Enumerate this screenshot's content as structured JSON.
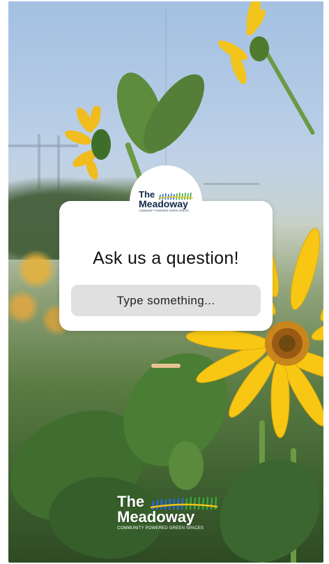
{
  "question_sticker": {
    "prompt": "Ask us a question!",
    "input_placeholder": "Type something..."
  },
  "brand": {
    "name_line1": "The",
    "name_line2": "Meadoway",
    "tagline": "COMMUNITY POWERED GREEN SPACES"
  },
  "colors": {
    "brand_navy": "#12284a",
    "input_bg": "#e0e0e0",
    "card_bg": "#ffffff",
    "grass_blue": "#2a6bd8",
    "grass_green": "#3aa53a",
    "grass_yellow": "#f2c318"
  },
  "icons": {
    "logo_grass": "meadow-grass-icon"
  }
}
